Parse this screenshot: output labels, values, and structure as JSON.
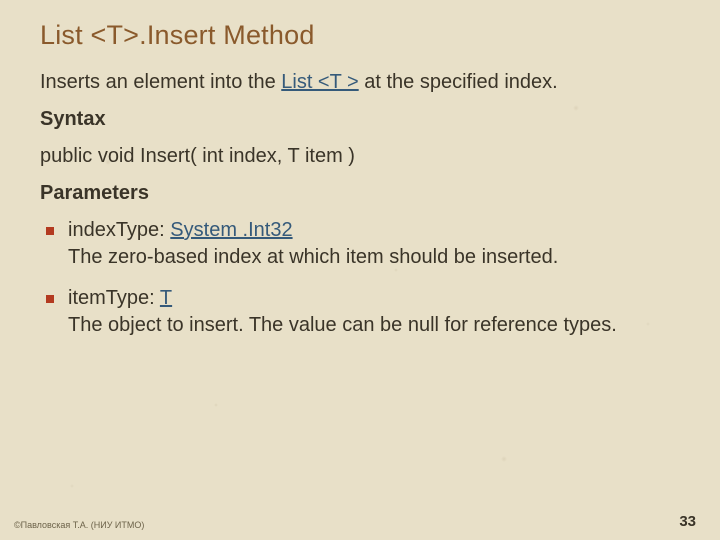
{
  "title": "List <T>.Insert Method",
  "intro": {
    "before": "Inserts an element into the ",
    "link": "List <T >",
    "after": " at the specified index."
  },
  "syntax_heading": "Syntax",
  "syntax_code": "public void Insert( int index, T item )",
  "params_heading": "Parameters",
  "params": [
    {
      "name_before": "indexType: ",
      "type_link": "System .Int32",
      "desc": "The zero-based index at which item should be inserted."
    },
    {
      "name_before": "itemType: ",
      "type_link": "T",
      "desc": "The object to insert. The value can be null for reference types."
    }
  ],
  "footer": {
    "copyright": "©Павловская Т.А. (НИУ ИТМО)",
    "page": "33"
  }
}
